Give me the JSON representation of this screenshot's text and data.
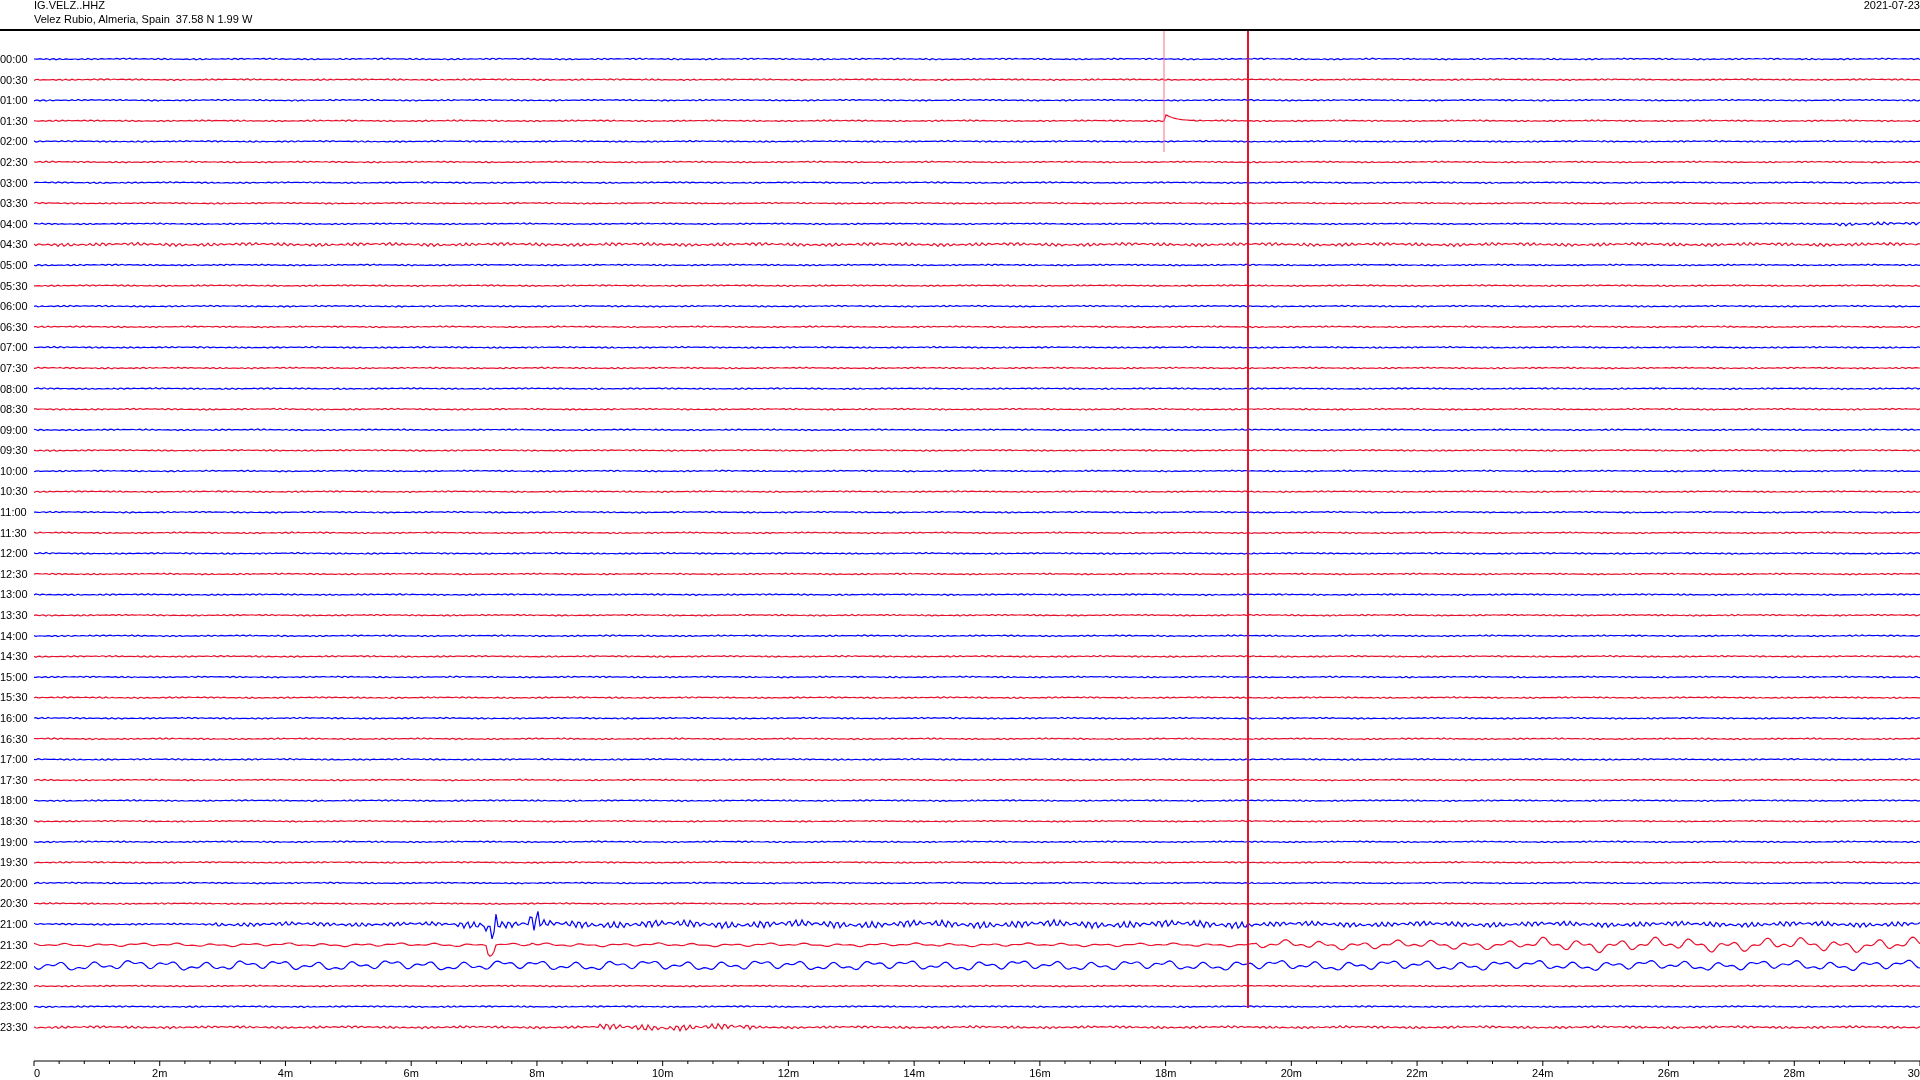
{
  "header": {
    "station": "IG.VELZ..HHZ",
    "location": "Velez Rubio, Almeria, Spain  37.58 N 1.99 W",
    "date": "2021-07-23"
  },
  "rows": [
    {
      "label": "00:00",
      "color": "#0000ff"
    },
    {
      "label": "00:30",
      "color": "#e8112d"
    },
    {
      "label": "01:00",
      "color": "#0000ff"
    },
    {
      "label": "01:30",
      "color": "#e8112d"
    },
    {
      "label": "02:00",
      "color": "#0000ff"
    },
    {
      "label": "02:30",
      "color": "#e8112d"
    },
    {
      "label": "03:00",
      "color": "#0000ff"
    },
    {
      "label": "03:30",
      "color": "#e8112d"
    },
    {
      "label": "04:00",
      "color": "#0000ff"
    },
    {
      "label": "04:30",
      "color": "#e8112d"
    },
    {
      "label": "05:00",
      "color": "#0000ff"
    },
    {
      "label": "05:30",
      "color": "#e8112d"
    },
    {
      "label": "06:00",
      "color": "#0000ff"
    },
    {
      "label": "06:30",
      "color": "#e8112d"
    },
    {
      "label": "07:00",
      "color": "#0000ff"
    },
    {
      "label": "07:30",
      "color": "#e8112d"
    },
    {
      "label": "08:00",
      "color": "#0000ff"
    },
    {
      "label": "08:30",
      "color": "#e8112d"
    },
    {
      "label": "09:00",
      "color": "#0000ff"
    },
    {
      "label": "09:30",
      "color": "#e8112d"
    },
    {
      "label": "10:00",
      "color": "#0000ff"
    },
    {
      "label": "10:30",
      "color": "#e8112d"
    },
    {
      "label": "11:00",
      "color": "#0000ff"
    },
    {
      "label": "11:30",
      "color": "#e8112d"
    },
    {
      "label": "12:00",
      "color": "#0000ff"
    },
    {
      "label": "12:30",
      "color": "#e8112d"
    },
    {
      "label": "13:00",
      "color": "#0000ff"
    },
    {
      "label": "13:30",
      "color": "#e8112d"
    },
    {
      "label": "14:00",
      "color": "#0000ff"
    },
    {
      "label": "14:30",
      "color": "#e8112d"
    },
    {
      "label": "15:00",
      "color": "#0000ff"
    },
    {
      "label": "15:30",
      "color": "#e8112d"
    },
    {
      "label": "16:00",
      "color": "#0000ff"
    },
    {
      "label": "16:30",
      "color": "#e8112d"
    },
    {
      "label": "17:00",
      "color": "#0000ff"
    },
    {
      "label": "17:30",
      "color": "#e8112d"
    },
    {
      "label": "18:00",
      "color": "#0000ff"
    },
    {
      "label": "18:30",
      "color": "#e8112d"
    },
    {
      "label": "19:00",
      "color": "#0000ff"
    },
    {
      "label": "19:30",
      "color": "#e8112d"
    },
    {
      "label": "20:00",
      "color": "#0000ff"
    },
    {
      "label": "20:30",
      "color": "#e8112d"
    },
    {
      "label": "21:00",
      "color": "#0000ff"
    },
    {
      "label": "21:30",
      "color": "#e8112d"
    },
    {
      "label": "22:00",
      "color": "#0000ff"
    },
    {
      "label": "22:30",
      "color": "#e8112d"
    },
    {
      "label": "23:00",
      "color": "#0000ff"
    },
    {
      "label": "23:30",
      "color": "#e8112d"
    }
  ],
  "x_axis": {
    "ticks": [
      "0",
      "2m",
      "4m",
      "6m",
      "8m",
      "10m",
      "12m",
      "14m",
      "16m",
      "18m",
      "20m",
      "22m",
      "24m",
      "26m",
      "28m",
      "30"
    ]
  }
}
